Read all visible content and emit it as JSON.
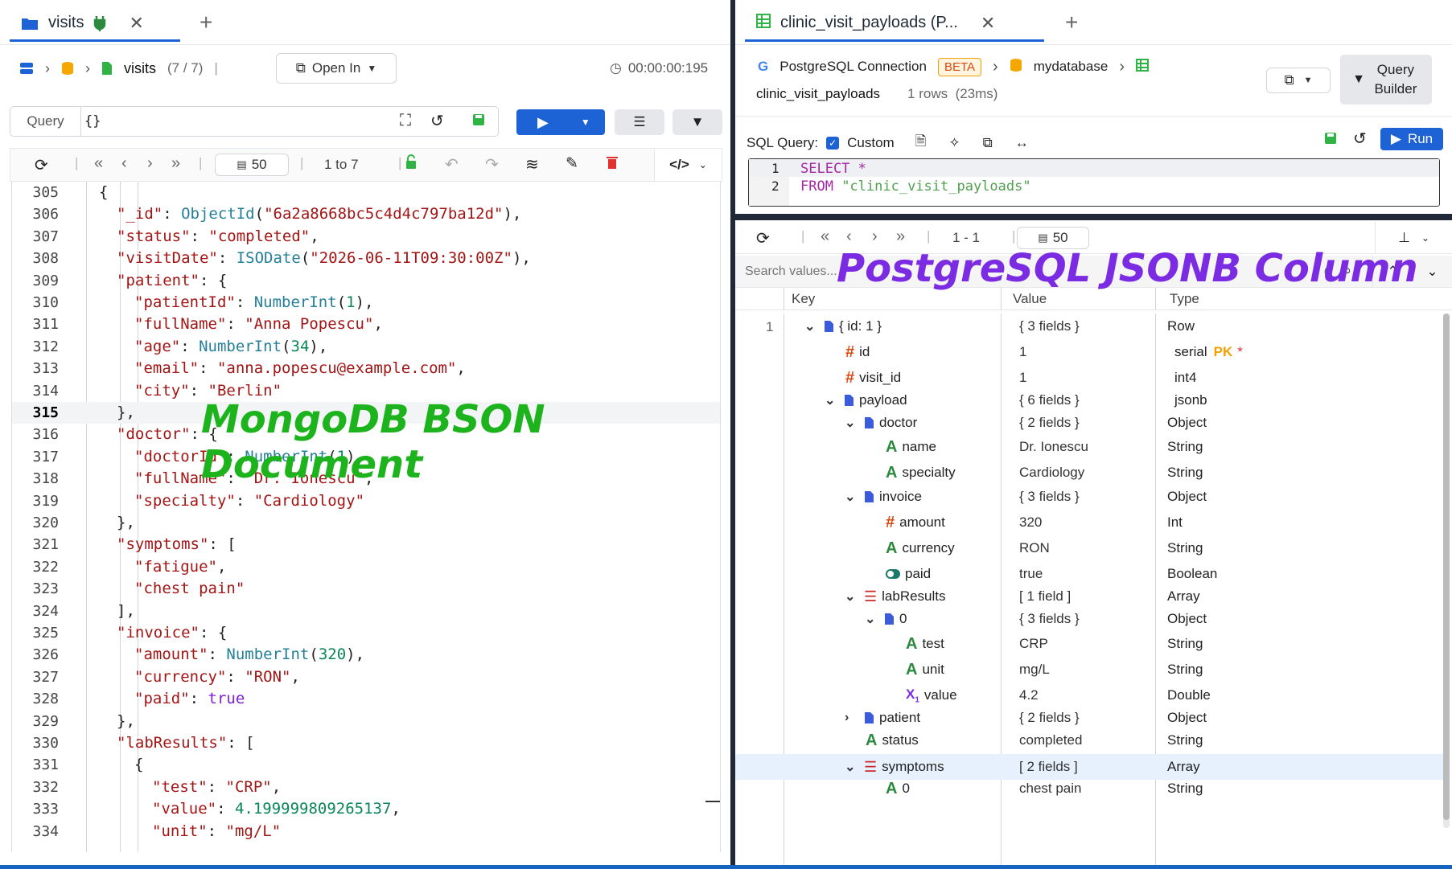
{
  "left": {
    "tab": {
      "title": "visits"
    },
    "breadcrumb": {
      "collection": "visits",
      "count": "(7 / 7)",
      "open_in": "Open In",
      "timer": "00:00:00:195"
    },
    "query": {
      "label": "Query",
      "value": "{}"
    },
    "paging": {
      "page_size": "50",
      "range": "1 to 7"
    },
    "code_lines": [
      {
        "n": "305",
        "html": "<span class='p'>{</span>",
        "indent": 1
      },
      {
        "n": "306",
        "html": "<span class='k'>\"_id\"</span><span class='p'>: </span><span class='f'>ObjectId</span><span class='p'>(</span><span class='s'>\"6a2a8668bc5c4d4c797ba12d\"</span><span class='p'>),</span>",
        "indent": 2
      },
      {
        "n": "307",
        "html": "<span class='k'>\"status\"</span><span class='p'>: </span><span class='s'>\"completed\"</span><span class='p'>,</span>",
        "indent": 2
      },
      {
        "n": "308",
        "html": "<span class='k'>\"visitDate\"</span><span class='p'>: </span><span class='f'>ISODate</span><span class='p'>(</span><span class='s'>\"2026-06-11T09:30:00Z\"</span><span class='p'>),</span>",
        "indent": 2
      },
      {
        "n": "309",
        "html": "<span class='k'>\"patient\"</span><span class='p'>: {</span>",
        "indent": 2
      },
      {
        "n": "310",
        "html": "<span class='k'>\"patientId\"</span><span class='p'>: </span><span class='f'>NumberInt</span><span class='p'>(</span><span class='n'>1</span><span class='p'>),</span>",
        "indent": 3
      },
      {
        "n": "311",
        "html": "<span class='k'>\"fullName\"</span><span class='p'>: </span><span class='s'>\"Anna Popescu\"</span><span class='p'>,</span>",
        "indent": 3
      },
      {
        "n": "312",
        "html": "<span class='k'>\"age\"</span><span class='p'>: </span><span class='f'>NumberInt</span><span class='p'>(</span><span class='n'>34</span><span class='p'>),</span>",
        "indent": 3
      },
      {
        "n": "313",
        "html": "<span class='k'>\"email\"</span><span class='p'>: </span><span class='s'>\"anna.popescu@example.com\"</span><span class='p'>,</span>",
        "indent": 3
      },
      {
        "n": "314",
        "html": "<span class='k'>\"city\"</span><span class='p'>: </span><span class='s'>\"Berlin\"</span>",
        "indent": 3
      },
      {
        "n": "315",
        "html": "<span class='p'>},</span>",
        "indent": 2,
        "current": true
      },
      {
        "n": "316",
        "html": "<span class='k'>\"doctor\"</span><span class='p'>: {</span>",
        "indent": 2
      },
      {
        "n": "317",
        "html": "<span class='k'>\"doctorId\"</span><span class='p'>: </span><span class='f'>NumberInt</span><span class='p'>(</span><span class='n'>1</span><span class='p'>),</span>",
        "indent": 3
      },
      {
        "n": "318",
        "html": "<span class='k'>\"fullName\"</span><span class='p'>: </span><span class='s'>\"Dr. Ionescu\"</span><span class='p'>,</span>",
        "indent": 3
      },
      {
        "n": "319",
        "html": "<span class='k'>\"specialty\"</span><span class='p'>: </span><span class='s'>\"Cardiology\"</span>",
        "indent": 3
      },
      {
        "n": "320",
        "html": "<span class='p'>},</span>",
        "indent": 2
      },
      {
        "n": "321",
        "html": "<span class='k'>\"symptoms\"</span><span class='p'>: [</span>",
        "indent": 2
      },
      {
        "n": "322",
        "html": "<span class='s'>\"fatigue\"</span><span class='p'>,</span>",
        "indent": 3
      },
      {
        "n": "323",
        "html": "<span class='s'>\"chest pain\"</span>",
        "indent": 3
      },
      {
        "n": "324",
        "html": "<span class='p'>],</span>",
        "indent": 2
      },
      {
        "n": "325",
        "html": "<span class='k'>\"invoice\"</span><span class='p'>: {</span>",
        "indent": 2
      },
      {
        "n": "326",
        "html": "<span class='k'>\"amount\"</span><span class='p'>: </span><span class='f'>NumberInt</span><span class='p'>(</span><span class='n'>320</span><span class='p'>),</span>",
        "indent": 3
      },
      {
        "n": "327",
        "html": "<span class='k'>\"currency\"</span><span class='p'>: </span><span class='s'>\"RON\"</span><span class='p'>,</span>",
        "indent": 3
      },
      {
        "n": "328",
        "html": "<span class='k'>\"paid\"</span><span class='p'>: </span><span class='b'>true</span>",
        "indent": 3
      },
      {
        "n": "329",
        "html": "<span class='p'>},</span>",
        "indent": 2
      },
      {
        "n": "330",
        "html": "<span class='k'>\"labResults\"</span><span class='p'>: [</span>",
        "indent": 2
      },
      {
        "n": "331",
        "html": "<span class='p'>{</span>",
        "indent": 3
      },
      {
        "n": "332",
        "html": "<span class='k'>\"test\"</span><span class='p'>: </span><span class='s'>\"CRP\"</span><span class='p'>,</span>",
        "indent": 4
      },
      {
        "n": "333",
        "html": "<span class='k'>\"value\"</span><span class='p'>: </span><span class='n'>4.199999809265137</span><span class='p'>,</span>",
        "indent": 4
      },
      {
        "n": "334",
        "html": "<span class='k'>\"unit\"</span><span class='p'>: </span><span class='s'>\"mg/L\"</span>",
        "indent": 4
      }
    ],
    "overlay": "MongoDB BSON Document"
  },
  "right": {
    "tab": {
      "title": "clinic_visit_payloads (P..."
    },
    "connection": {
      "name": "PostgreSQL Connection",
      "badge": "BETA",
      "database": "mydatabase",
      "table": "clinic_visit_payloads",
      "rows": "1 rows",
      "time": "(23ms)"
    },
    "query_builder": "Query Builder",
    "sql": {
      "label": "SQL Query:",
      "custom": "Custom",
      "run": "Run",
      "line1": "SELECT *",
      "line2": "FROM \"clinic_visit_payloads\""
    },
    "paging": {
      "range": "1 - 1",
      "page_size": "50"
    },
    "search": {
      "placeholder": "Search values...",
      "count": "0"
    },
    "columns": {
      "key": "Key",
      "value": "Value",
      "type": "Type"
    },
    "overlay": "PostgreSQL JSONB Column",
    "rows": [
      {
        "key": "{ id: 1 }",
        "value": "{ 3 fields }",
        "type": "Row",
        "icon": "doc",
        "chev": "v",
        "lvl": 0,
        "rownum": "1"
      },
      {
        "key": "id",
        "value": "1",
        "type": "serial",
        "pk": "PK",
        "icon": "hash",
        "lvl": 1
      },
      {
        "key": "visit_id",
        "value": "1",
        "type": "int4",
        "icon": "hash",
        "lvl": 1
      },
      {
        "key": "payload",
        "value": "{ 6 fields }",
        "type": "jsonb",
        "icon": "doc",
        "chev": "v",
        "lvl": 1
      },
      {
        "key": "doctor",
        "value": "{ 2 fields }",
        "type": "Object",
        "icon": "doc",
        "chev": "v",
        "lvl": 2
      },
      {
        "key": "name",
        "value": "Dr. Ionescu",
        "type": "String",
        "icon": "A",
        "lvl": 3
      },
      {
        "key": "specialty",
        "value": "Cardiology",
        "type": "String",
        "icon": "A",
        "lvl": 3
      },
      {
        "key": "invoice",
        "value": "{ 3 fields }",
        "type": "Object",
        "icon": "doc",
        "chev": "v",
        "lvl": 2
      },
      {
        "key": "amount",
        "value": "320",
        "type": "Int",
        "icon": "hash",
        "lvl": 3
      },
      {
        "key": "currency",
        "value": "RON",
        "type": "String",
        "icon": "A",
        "lvl": 3
      },
      {
        "key": "paid",
        "value": "true",
        "type": "Boolean",
        "icon": "toggle",
        "lvl": 3
      },
      {
        "key": "labResults",
        "value": "[ 1 field ]",
        "type": "Array",
        "icon": "arr",
        "chev": "v",
        "lvl": 2
      },
      {
        "key": "0",
        "value": "{ 3 fields }",
        "type": "Object",
        "icon": "doc",
        "chev": "v",
        "lvl": 3
      },
      {
        "key": "test",
        "value": "CRP",
        "type": "String",
        "icon": "A",
        "lvl": 4
      },
      {
        "key": "unit",
        "value": "mg/L",
        "type": "String",
        "icon": "A",
        "lvl": 4
      },
      {
        "key": "value",
        "value": "4.2",
        "type": "Double",
        "icon": "x1",
        "lvl": 4
      },
      {
        "key": "patient",
        "value": "{ 2 fields }",
        "type": "Object",
        "icon": "doc",
        "chev": ">",
        "lvl": 2
      },
      {
        "key": "status",
        "value": "completed",
        "type": "String",
        "icon": "A",
        "lvl": 2
      },
      {
        "key": "symptoms",
        "value": "[ 2 fields ]",
        "type": "Array",
        "icon": "arr",
        "chev": "v",
        "lvl": 2,
        "selected": true
      },
      {
        "key": "0",
        "value": "chest pain",
        "type": "String",
        "icon": "A",
        "lvl": 3
      }
    ]
  },
  "colors": {
    "accent": "#1e63d6",
    "overlay_green": "#1db31d",
    "overlay_purple": "#7b2be2",
    "pk": "#f59f00"
  }
}
